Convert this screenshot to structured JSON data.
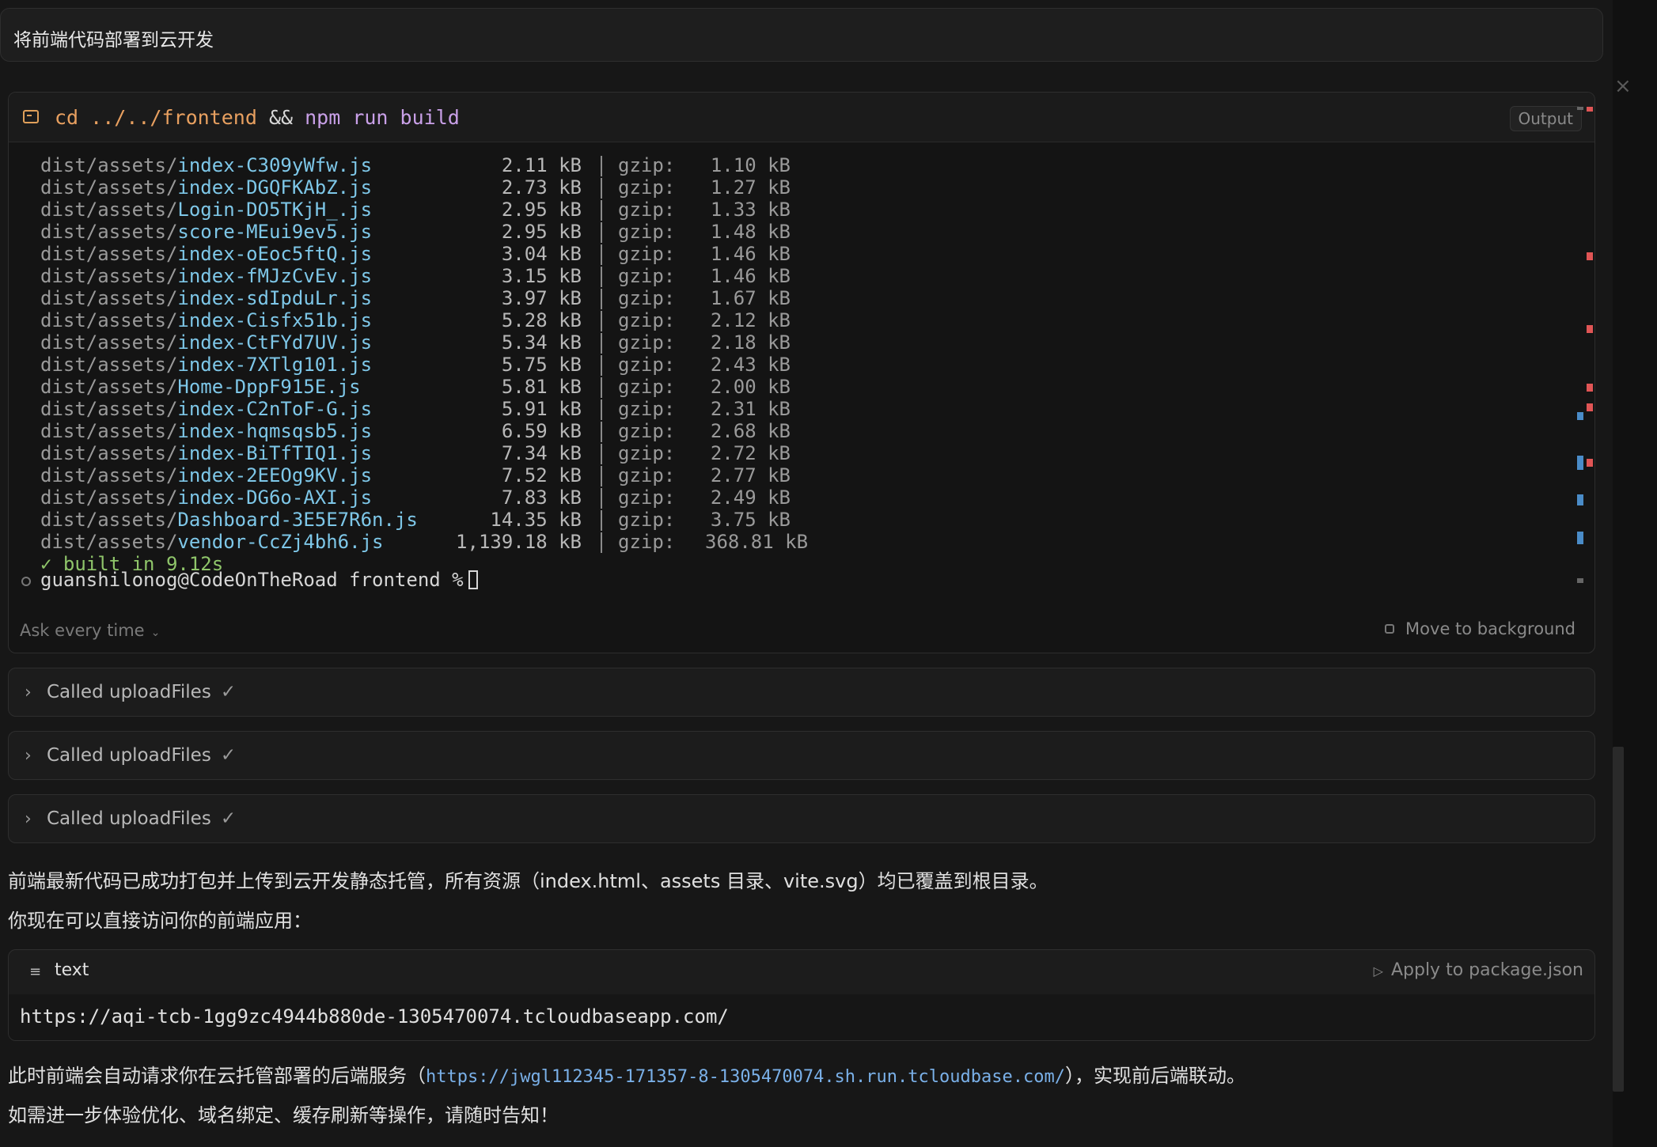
{
  "user_message": "将前端代码部署到云开发",
  "terminal": {
    "command": {
      "cd": "cd",
      "path": "../../frontend",
      "op": "&&",
      "npm": "npm run build"
    },
    "output_label": "Output",
    "build_lines": [
      {
        "dir": "dist/assets/",
        "file": "index-C309yWfw.js",
        "size": "2.11 kB",
        "gzip_label": "gzip:",
        "gzip": "1.10 kB"
      },
      {
        "dir": "dist/assets/",
        "file": "index-DGQFKAbZ.js",
        "size": "2.73 kB",
        "gzip_label": "gzip:",
        "gzip": "1.27 kB"
      },
      {
        "dir": "dist/assets/",
        "file": "Login-DO5TKjH_.js",
        "size": "2.95 kB",
        "gzip_label": "gzip:",
        "gzip": "1.33 kB"
      },
      {
        "dir": "dist/assets/",
        "file": "score-MEui9ev5.js",
        "size": "2.95 kB",
        "gzip_label": "gzip:",
        "gzip": "1.48 kB"
      },
      {
        "dir": "dist/assets/",
        "file": "index-oEoc5ftQ.js",
        "size": "3.04 kB",
        "gzip_label": "gzip:",
        "gzip": "1.46 kB"
      },
      {
        "dir": "dist/assets/",
        "file": "index-fMJzCvEv.js",
        "size": "3.15 kB",
        "gzip_label": "gzip:",
        "gzip": "1.46 kB"
      },
      {
        "dir": "dist/assets/",
        "file": "index-sdIpduLr.js",
        "size": "3.97 kB",
        "gzip_label": "gzip:",
        "gzip": "1.67 kB"
      },
      {
        "dir": "dist/assets/",
        "file": "index-Cisfx51b.js",
        "size": "5.28 kB",
        "gzip_label": "gzip:",
        "gzip": "2.12 kB"
      },
      {
        "dir": "dist/assets/",
        "file": "index-CtFYd7UV.js",
        "size": "5.34 kB",
        "gzip_label": "gzip:",
        "gzip": "2.18 kB"
      },
      {
        "dir": "dist/assets/",
        "file": "index-7XTlg101.js",
        "size": "5.75 kB",
        "gzip_label": "gzip:",
        "gzip": "2.43 kB"
      },
      {
        "dir": "dist/assets/",
        "file": "Home-DppF915E.js",
        "size": "5.81 kB",
        "gzip_label": "gzip:",
        "gzip": "2.00 kB"
      },
      {
        "dir": "dist/assets/",
        "file": "index-C2nToF-G.js",
        "size": "5.91 kB",
        "gzip_label": "gzip:",
        "gzip": "2.31 kB"
      },
      {
        "dir": "dist/assets/",
        "file": "index-hqmsqsb5.js",
        "size": "6.59 kB",
        "gzip_label": "gzip:",
        "gzip": "2.68 kB"
      },
      {
        "dir": "dist/assets/",
        "file": "index-BiTfTIQ1.js",
        "size": "7.34 kB",
        "gzip_label": "gzip:",
        "gzip": "2.72 kB"
      },
      {
        "dir": "dist/assets/",
        "file": "index-2EEOg9KV.js",
        "size": "7.52 kB",
        "gzip_label": "gzip:",
        "gzip": "2.77 kB"
      },
      {
        "dir": "dist/assets/",
        "file": "index-DG6o-AXI.js",
        "size": "7.83 kB",
        "gzip_label": "gzip:",
        "gzip": "2.49 kB"
      },
      {
        "dir": "dist/assets/",
        "file": "Dashboard-3E5E7R6n.js",
        "size": "14.35 kB",
        "gzip_label": "gzip:",
        "gzip": "3.75 kB"
      },
      {
        "dir": "dist/assets/",
        "file": "vendor-CcZj4bh6.js",
        "size": "1,139.18 kB",
        "gzip_label": "gzip:",
        "gzip": "368.81 kB"
      }
    ],
    "built_line": "✓ built in 9.12s",
    "prompt": "guanshilonog@CodeOnTheRoad frontend %",
    "ask_label": "Ask every time",
    "move_bg_label": "Move to background"
  },
  "tool_calls": [
    {
      "label": "Called uploadFiles",
      "check": "✓"
    },
    {
      "label": "Called uploadFiles",
      "check": "✓"
    },
    {
      "label": "Called uploadFiles",
      "check": "✓"
    }
  ],
  "response": {
    "para1": "前端最新代码已成功打包并上传到云开发静态托管，所有资源（index.html、assets 目录、vite.svg）均已覆盖到根目录。",
    "para2": "你现在可以直接访问你的前端应用：",
    "code_block": {
      "lang": "text",
      "apply_label": "Apply to package.json",
      "url": "https://aqi-tcb-1gg9zc4944b880de-1305470074.tcloudbaseapp.com/"
    },
    "para3_prefix": "此时前端会自动请求你在云托管部署的后端服务（",
    "para3_link": "https://jwgl112345-171357-8-1305470074.sh.run.tcloudbase.com/",
    "para3_suffix": "），实现前后端联动。",
    "para4": "如需进一步体验优化、域名绑定、缓存刷新等操作，请随时告知！"
  },
  "colors": {
    "accent_orange": "#e8a060",
    "file_blue": "#7ec7e8",
    "link_blue": "#7ab0e8",
    "built_green": "#8fc56a"
  }
}
